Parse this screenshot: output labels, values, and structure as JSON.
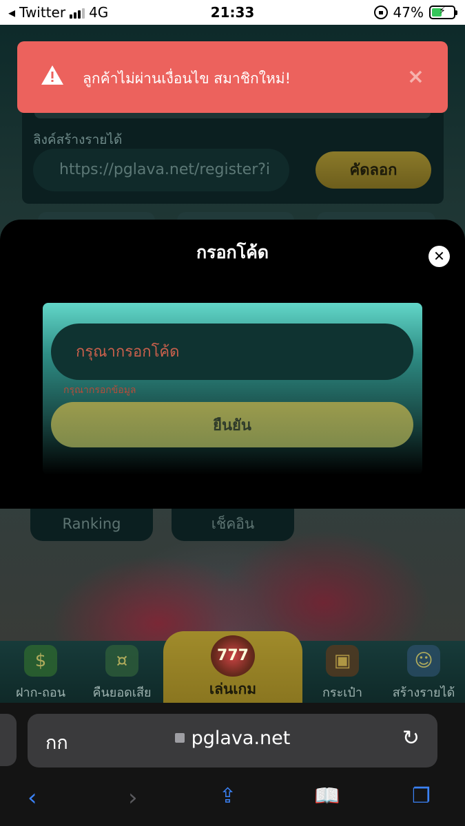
{
  "status_bar": {
    "carrier": "Twitter",
    "network": "4G",
    "time": "21:33",
    "battery": "47%",
    "battery_level": 0.47
  },
  "toast": {
    "message": "ลูกค้าไม่ผ่านเงื่อนไข สมาชิกใหม่!",
    "close_symbol": "×",
    "color": "#ec625d"
  },
  "referral": {
    "label": "ลิงค์สร้างรายได้",
    "link_value": "https://pglava.net/register?i",
    "copy_label": "คัดลอก"
  },
  "modal": {
    "title": "กรอกโค้ด",
    "close_symbol": "✕",
    "input_placeholder": "กรุณากรอกโค้ด",
    "error_text": "กรุณากรอกข้อมูล",
    "confirm_label": "ยืนยัน"
  },
  "below_modal": {
    "ranking": "Ranking",
    "checkin": "เช็คอิน"
  },
  "bottom_nav": {
    "items": [
      {
        "label": "ฝาก-ถอน",
        "icon": "deposit-withdraw-icon"
      },
      {
        "label": "คืนยอดเสีย",
        "icon": "cashback-icon"
      },
      {
        "label": "เล่นเกม",
        "icon": "slot-machine-icon"
      },
      {
        "label": "กระเป๋า",
        "icon": "wallet-icon"
      },
      {
        "label": "สร้างรายได้",
        "icon": "earn-icon"
      }
    ]
  },
  "browser": {
    "aa_label": "กก",
    "url": "pglava.net"
  },
  "colors": {
    "accent_gold": "#a08b2b",
    "modal_teal": "#62d6c8",
    "ios_blue": "#3b82f6"
  }
}
